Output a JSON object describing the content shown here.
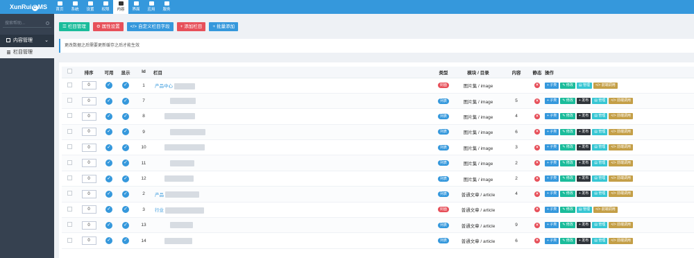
{
  "logo": {
    "text_a": "XunRui",
    "text_c": "C",
    "text_b": "MS"
  },
  "nav": [
    {
      "label": "首页",
      "icon": "home-icon"
    },
    {
      "label": "系统",
      "icon": "gear-icon"
    },
    {
      "label": "设置",
      "icon": "sliders-icon"
    },
    {
      "label": "权限",
      "icon": "user-icon"
    },
    {
      "label": "内容",
      "icon": "grid-icon",
      "active": true
    },
    {
      "label": "界面",
      "icon": "trash-icon"
    },
    {
      "label": "应用",
      "icon": "puzzle-icon"
    },
    {
      "label": "服务",
      "icon": "cloud-icon"
    }
  ],
  "sidebar": {
    "search_placeholder": "搜索帮助...",
    "group_label": "内容管理",
    "sub_label": "栏目管理"
  },
  "toolbar": [
    {
      "label": "栏目管理",
      "icon": "list-icon",
      "color": "#1bbc9b"
    },
    {
      "label": "属性设置",
      "icon": "cog-icon",
      "color": "#e7505a"
    },
    {
      "label": "自定义栏目字段",
      "icon": "code-icon",
      "color": "#3598dc"
    },
    {
      "label": "添加栏目",
      "icon": "plus-icon",
      "color": "#e7505a"
    },
    {
      "label": "批量添加",
      "icon": "plus-icon",
      "color": "#3598dc"
    }
  ],
  "notice": "更改数据之后需要更新缓存之后才能生效",
  "table": {
    "headers": [
      "",
      "排序",
      "可用",
      "显示",
      "Id",
      "栏目",
      "类型",
      "模块 / 目录",
      "内容",
      "静态",
      "操作"
    ],
    "rows": [
      {
        "sort": "0",
        "id": "1",
        "name": "产品中心",
        "type": "封面",
        "module": "图片集 / image",
        "count": "",
        "ops": [
          "+ 子类",
          "修改",
          "管理",
          "前端调用"
        ]
      },
      {
        "sort": "0",
        "id": "7",
        "name": "",
        "type": "列表",
        "module": "图片集 / image",
        "count": "5",
        "ops": [
          "+ 子类",
          "修改",
          "+ 发布",
          "管理",
          "前端调用"
        ]
      },
      {
        "sort": "0",
        "id": "8",
        "name": "",
        "type": "列表",
        "module": "图片集 / image",
        "count": "4",
        "ops": [
          "+ 子类",
          "修改",
          "+ 发布",
          "管理",
          "前端调用"
        ]
      },
      {
        "sort": "0",
        "id": "9",
        "name": "",
        "type": "列表",
        "module": "图片集 / image",
        "count": "6",
        "ops": [
          "+ 子类",
          "修改",
          "+ 发布",
          "管理",
          "前端调用"
        ]
      },
      {
        "sort": "0",
        "id": "10",
        "name": "",
        "type": "列表",
        "module": "图片集 / image",
        "count": "3",
        "ops": [
          "+ 子类",
          "修改",
          "+ 发布",
          "管理",
          "前端调用"
        ]
      },
      {
        "sort": "0",
        "id": "11",
        "name": "",
        "type": "列表",
        "module": "图片集 / image",
        "count": "2",
        "ops": [
          "+ 子类",
          "修改",
          "+ 发布",
          "管理",
          "前端调用"
        ]
      },
      {
        "sort": "0",
        "id": "12",
        "name": "",
        "type": "列表",
        "module": "图片集 / image",
        "count": "2",
        "ops": [
          "+ 子类",
          "修改",
          "+ 发布",
          "管理",
          "前端调用"
        ]
      },
      {
        "sort": "0",
        "id": "2",
        "name": "产品",
        "type": "列表",
        "module": "普通文章 / article",
        "count": "4",
        "ops": [
          "+ 子类",
          "修改",
          "+ 发布",
          "管理",
          "前端调用"
        ]
      },
      {
        "sort": "0",
        "id": "3",
        "name": "行业",
        "type": "封面",
        "module": "普通文章 / article",
        "count": "",
        "ops": [
          "+ 子类",
          "修改",
          "管理",
          "前端调用"
        ]
      },
      {
        "sort": "0",
        "id": "13",
        "name": "",
        "type": "列表",
        "module": "普通文章 / article",
        "count": "9",
        "ops": [
          "+ 子类",
          "修改",
          "+ 发布",
          "管理",
          "前端调用"
        ]
      },
      {
        "sort": "0",
        "id": "14",
        "name": "",
        "type": "列表",
        "module": "普通文章 / article",
        "count": "6",
        "ops": [
          "+ 子类",
          "修改",
          "+ 发布",
          "管理",
          "前端调用"
        ]
      }
    ]
  },
  "colors": {
    "primary": "#3598dc",
    "sidebar": "#364150",
    "danger": "#e7505a",
    "success": "#1bbc9b"
  }
}
